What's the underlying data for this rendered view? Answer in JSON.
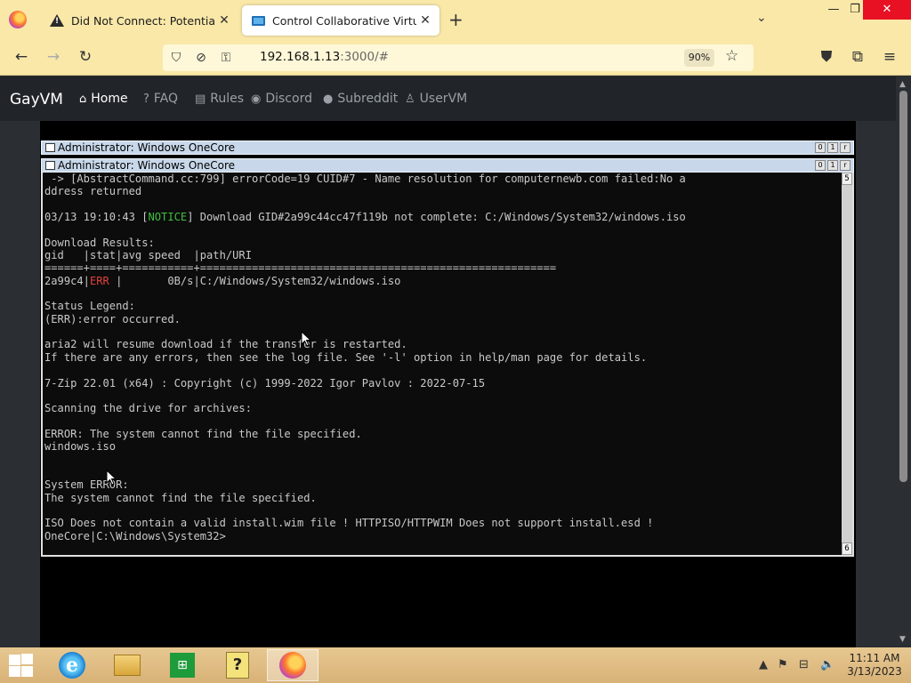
{
  "browser": {
    "tabs": [
      {
        "title": "Did Not Connect: Potential Sec",
        "icon": "warning-icon",
        "active": false
      },
      {
        "title": "Control Collaborative Virtual M",
        "icon": "monitor-icon",
        "active": true
      }
    ],
    "url_host": "192.168.1.13",
    "url_rest": ":3000/#",
    "zoom": "90%"
  },
  "site": {
    "brand": "GayVM",
    "nav": [
      {
        "label": "Home",
        "icon": "home-icon",
        "active": true
      },
      {
        "label": "FAQ",
        "icon": "question-icon"
      },
      {
        "label": "Rules",
        "icon": "clipboard-icon"
      },
      {
        "label": "Discord",
        "icon": "discord-icon"
      },
      {
        "label": "Subreddit",
        "icon": "reddit-icon"
      },
      {
        "label": "UserVM",
        "icon": "user-icon"
      }
    ]
  },
  "vm": {
    "window_titles": [
      "Administrator:  Windows OneCore",
      "Administrator:  Windows OneCore"
    ],
    "console_lines": [
      " -> [AbstractCommand.cc:799] errorCode=19 CUID#7 - Name resolution for computernewb.com failed:No a",
      "ddress returned",
      "",
      "03/13 19:10:43 [NOTICE] Download GID#2a99c44cc47f119b not complete: C:/Windows/System32/windows.iso",
      "",
      "Download Results:",
      "gid   |stat|avg speed  |path/URI",
      "======+====+===========+=======================================================",
      "2a99c4|ERR |       0B/s|C:/Windows/System32/windows.iso",
      "",
      "Status Legend:",
      "(ERR):error occurred.",
      "",
      "aria2 will resume download if the transfer is restarted.",
      "If there are any errors, then see the log file. See '-l' option in help/man page for details.",
      "",
      "7-Zip 22.01 (x64) : Copyright (c) 1999-2022 Igor Pavlov : 2022-07-15",
      "",
      "Scanning the drive for archives:",
      "",
      "ERROR: The system cannot find the file specified.",
      "windows.iso",
      "",
      "",
      "System ERROR:",
      "The system cannot find the file specified.",
      "",
      "ISO Does not contain a valid install.wim file ! HTTPISO/HTTPWIM Does not support install.esd !",
      "OneCore|C:\\Windows\\System32>"
    ],
    "scroll_top_num": "5",
    "scroll_bottom_num": "6"
  },
  "taskbar": {
    "time": "11:11 AM",
    "date": "3/13/2023"
  }
}
